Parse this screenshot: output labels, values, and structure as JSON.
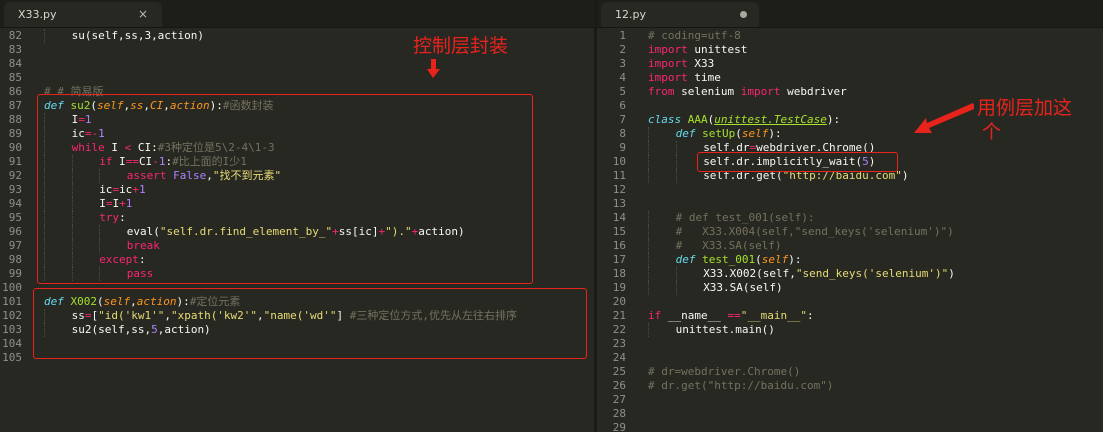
{
  "left_tab": {
    "title": "X33.py",
    "close": "×"
  },
  "right_tab": {
    "title": "12.py"
  },
  "left_lines": [
    {
      "n": "82",
      "g": 1,
      "t": [
        [
          "su(self,ss,3,action)",
          ""
        ]
      ]
    },
    {
      "n": "83",
      "g": 0,
      "t": []
    },
    {
      "n": "84",
      "g": 0,
      "t": []
    },
    {
      "n": "85",
      "g": 0,
      "t": []
    },
    {
      "n": "86",
      "g": 0,
      "t": [
        [
          "# # 简易版",
          "c"
        ]
      ]
    },
    {
      "n": "87",
      "g": 0,
      "t": [
        [
          "def",
          "st"
        ],
        [
          " ",
          ""
        ],
        [
          "su2",
          "fn"
        ],
        [
          "(",
          ""
        ],
        [
          "self",
          "p"
        ],
        [
          ",",
          ""
        ],
        [
          "ss",
          "p"
        ],
        [
          ",",
          ""
        ],
        [
          "CI",
          "p"
        ],
        [
          ",",
          ""
        ],
        [
          "action",
          "p"
        ],
        [
          "):",
          ""
        ],
        [
          "#函数封装",
          "c"
        ]
      ]
    },
    {
      "n": "88",
      "g": 1,
      "t": [
        [
          "I",
          ""
        ],
        [
          "=",
          "k"
        ],
        [
          "1",
          "n"
        ]
      ]
    },
    {
      "n": "89",
      "g": 1,
      "t": [
        [
          "ic",
          ""
        ],
        [
          "=",
          "k"
        ],
        [
          "-",
          "k"
        ],
        [
          "1",
          "n"
        ]
      ]
    },
    {
      "n": "90",
      "g": 1,
      "t": [
        [
          "while",
          "k"
        ],
        [
          " I ",
          ""
        ],
        [
          "<",
          "k"
        ],
        [
          " CI:",
          ""
        ],
        [
          "#3种定位是5\\2-4\\1-3",
          "c"
        ]
      ]
    },
    {
      "n": "91",
      "g": 2,
      "t": [
        [
          "if",
          "k"
        ],
        [
          " I",
          ""
        ],
        [
          "==",
          "k"
        ],
        [
          "CI",
          ""
        ],
        [
          "-",
          "k"
        ],
        [
          "1",
          "n"
        ],
        [
          ":",
          ""
        ],
        [
          "#比上面的I少1",
          "c"
        ]
      ]
    },
    {
      "n": "92",
      "g": 3,
      "t": [
        [
          "assert",
          "k"
        ],
        [
          " ",
          ""
        ],
        [
          "False",
          "n"
        ],
        [
          ",",
          ""
        ],
        [
          "\"找不到元素\"",
          "s"
        ]
      ]
    },
    {
      "n": "93",
      "g": 2,
      "t": [
        [
          "ic",
          ""
        ],
        [
          "=",
          "k"
        ],
        [
          "ic",
          ""
        ],
        [
          "+",
          "k"
        ],
        [
          "1",
          "n"
        ]
      ]
    },
    {
      "n": "94",
      "g": 2,
      "t": [
        [
          "I",
          ""
        ],
        [
          "=",
          "k"
        ],
        [
          "I",
          ""
        ],
        [
          "+",
          "k"
        ],
        [
          "1",
          "n"
        ]
      ]
    },
    {
      "n": "95",
      "g": 2,
      "t": [
        [
          "try",
          "k"
        ],
        [
          ":",
          ""
        ]
      ]
    },
    {
      "n": "96",
      "g": 3,
      "t": [
        [
          "eval(",
          ""
        ],
        [
          "\"self.dr.find_element_by_\"",
          "s"
        ],
        [
          "+",
          "k"
        ],
        [
          "ss[ic]",
          ""
        ],
        [
          "+",
          "k"
        ],
        [
          "\").\"",
          "s"
        ],
        [
          "+",
          "k"
        ],
        [
          "action)",
          ""
        ]
      ]
    },
    {
      "n": "97",
      "g": 3,
      "t": [
        [
          "break",
          "k"
        ]
      ]
    },
    {
      "n": "98",
      "g": 2,
      "t": [
        [
          "except",
          "k"
        ],
        [
          ":",
          ""
        ]
      ]
    },
    {
      "n": "99",
      "g": 3,
      "t": [
        [
          "pass",
          "k"
        ]
      ]
    },
    {
      "n": "100",
      "g": 0,
      "t": []
    },
    {
      "n": "101",
      "g": 0,
      "t": [
        [
          "def",
          "st"
        ],
        [
          " ",
          ""
        ],
        [
          "X002",
          "fn"
        ],
        [
          "(",
          ""
        ],
        [
          "self",
          "p"
        ],
        [
          ",",
          ""
        ],
        [
          "action",
          "p"
        ],
        [
          "):",
          ""
        ],
        [
          "#定位元素",
          "c"
        ]
      ]
    },
    {
      "n": "102",
      "g": 1,
      "t": [
        [
          "ss",
          ""
        ],
        [
          "=",
          "k"
        ],
        [
          "[",
          ""
        ],
        [
          "\"id('kw1'\"",
          "s"
        ],
        [
          ",",
          ""
        ],
        [
          "\"xpath('kw2'\"",
          "s"
        ],
        [
          ",",
          ""
        ],
        [
          "\"name('wd'\"",
          "s"
        ],
        [
          "] ",
          ""
        ],
        [
          "#三种定位方式,优先从左往右排序",
          "c"
        ]
      ]
    },
    {
      "n": "103",
      "g": 1,
      "t": [
        [
          "su2(self,ss,",
          ""
        ],
        [
          "5",
          "n"
        ],
        [
          ",action)",
          ""
        ]
      ]
    },
    {
      "n": "104",
      "g": 0,
      "t": []
    },
    {
      "n": "105",
      "g": 0,
      "t": []
    }
  ],
  "right_lines": [
    {
      "n": "1",
      "g": 0,
      "t": [
        [
          "# coding=utf-8",
          "c"
        ]
      ]
    },
    {
      "n": "2",
      "g": 0,
      "t": [
        [
          "import",
          "k"
        ],
        [
          " unittest",
          ""
        ]
      ]
    },
    {
      "n": "3",
      "g": 0,
      "t": [
        [
          "import",
          "k"
        ],
        [
          " X33",
          ""
        ]
      ]
    },
    {
      "n": "4",
      "g": 0,
      "t": [
        [
          "import",
          "k"
        ],
        [
          " time",
          ""
        ]
      ]
    },
    {
      "n": "5",
      "g": 0,
      "t": [
        [
          "from",
          "k"
        ],
        [
          " selenium ",
          ""
        ],
        [
          "import",
          "k"
        ],
        [
          " webdriver",
          ""
        ]
      ]
    },
    {
      "n": "6",
      "g": 0,
      "t": []
    },
    {
      "n": "7",
      "g": 0,
      "t": [
        [
          "class",
          "st"
        ],
        [
          " ",
          ""
        ],
        [
          "AAA",
          "fn"
        ],
        [
          "(",
          ""
        ],
        [
          "unittest.TestCase",
          "cl"
        ],
        [
          "):",
          ""
        ]
      ]
    },
    {
      "n": "8",
      "g": 1,
      "t": [
        [
          "def",
          "st"
        ],
        [
          " ",
          ""
        ],
        [
          "setUp",
          "fn"
        ],
        [
          "(",
          ""
        ],
        [
          "self",
          "p"
        ],
        [
          "):",
          ""
        ]
      ]
    },
    {
      "n": "9",
      "g": 2,
      "t": [
        [
          "self.dr",
          ""
        ],
        [
          "=",
          "k"
        ],
        [
          "webdriver.Chrome()",
          ""
        ]
      ]
    },
    {
      "n": "10",
      "g": 2,
      "t": [
        [
          "self.dr.implicitly_wait(",
          ""
        ],
        [
          "5",
          "n"
        ],
        [
          ")",
          ""
        ]
      ]
    },
    {
      "n": "11",
      "g": 2,
      "t": [
        [
          "self.dr.get(",
          ""
        ],
        [
          "\"http://baidu.com\"",
          "s"
        ],
        [
          ")",
          ""
        ]
      ]
    },
    {
      "n": "12",
      "g": 0,
      "t": []
    },
    {
      "n": "13",
      "g": 0,
      "t": []
    },
    {
      "n": "14",
      "g": 1,
      "t": [
        [
          "# def test_001(self):",
          "c"
        ]
      ]
    },
    {
      "n": "15",
      "g": 1,
      "t": [
        [
          "#   X33.X004(self,\"send_keys('selenium')\")",
          "c"
        ]
      ]
    },
    {
      "n": "16",
      "g": 1,
      "t": [
        [
          "#   X33.SA(self)",
          "c"
        ]
      ]
    },
    {
      "n": "17",
      "g": 1,
      "t": [
        [
          "def",
          "st"
        ],
        [
          " ",
          ""
        ],
        [
          "test_001",
          "fn"
        ],
        [
          "(",
          ""
        ],
        [
          "self",
          "p"
        ],
        [
          "):",
          ""
        ]
      ]
    },
    {
      "n": "18",
      "g": 2,
      "t": [
        [
          "X33.X002(self,",
          ""
        ],
        [
          "\"send_keys('selenium')\"",
          "s"
        ],
        [
          ")",
          ""
        ]
      ]
    },
    {
      "n": "19",
      "g": 2,
      "t": [
        [
          "X33.SA(self)",
          ""
        ]
      ]
    },
    {
      "n": "20",
      "g": 0,
      "t": []
    },
    {
      "n": "21",
      "g": 0,
      "t": [
        [
          "if",
          "k"
        ],
        [
          " __name__ ",
          ""
        ],
        [
          "==",
          "k"
        ],
        [
          "\"__main__\"",
          "s"
        ],
        [
          ":",
          ""
        ]
      ]
    },
    {
      "n": "22",
      "g": 1,
      "t": [
        [
          "unittest.main()",
          ""
        ]
      ]
    },
    {
      "n": "23",
      "g": 0,
      "t": []
    },
    {
      "n": "24",
      "g": 0,
      "t": []
    },
    {
      "n": "25",
      "g": 0,
      "t": [
        [
          "# dr=webdriver.Chrome()",
          "c"
        ]
      ]
    },
    {
      "n": "26",
      "g": 0,
      "t": [
        [
          "# dr.get(\"http://baidu.com\")",
          "c"
        ]
      ]
    },
    {
      "n": "27",
      "g": 0,
      "t": []
    },
    {
      "n": "28",
      "g": 0,
      "t": []
    },
    {
      "n": "29",
      "g": 0,
      "t": []
    }
  ],
  "annotations": {
    "control_layer": "控制层封装",
    "usecase_line1": "用例层加这",
    "usecase_line2": "个"
  },
  "colors": {
    "background": "#272822",
    "annotation": "#e8231c",
    "keyword": "#f92672",
    "function": "#a6e22e",
    "string": "#e6db74",
    "comment": "#75715e"
  }
}
